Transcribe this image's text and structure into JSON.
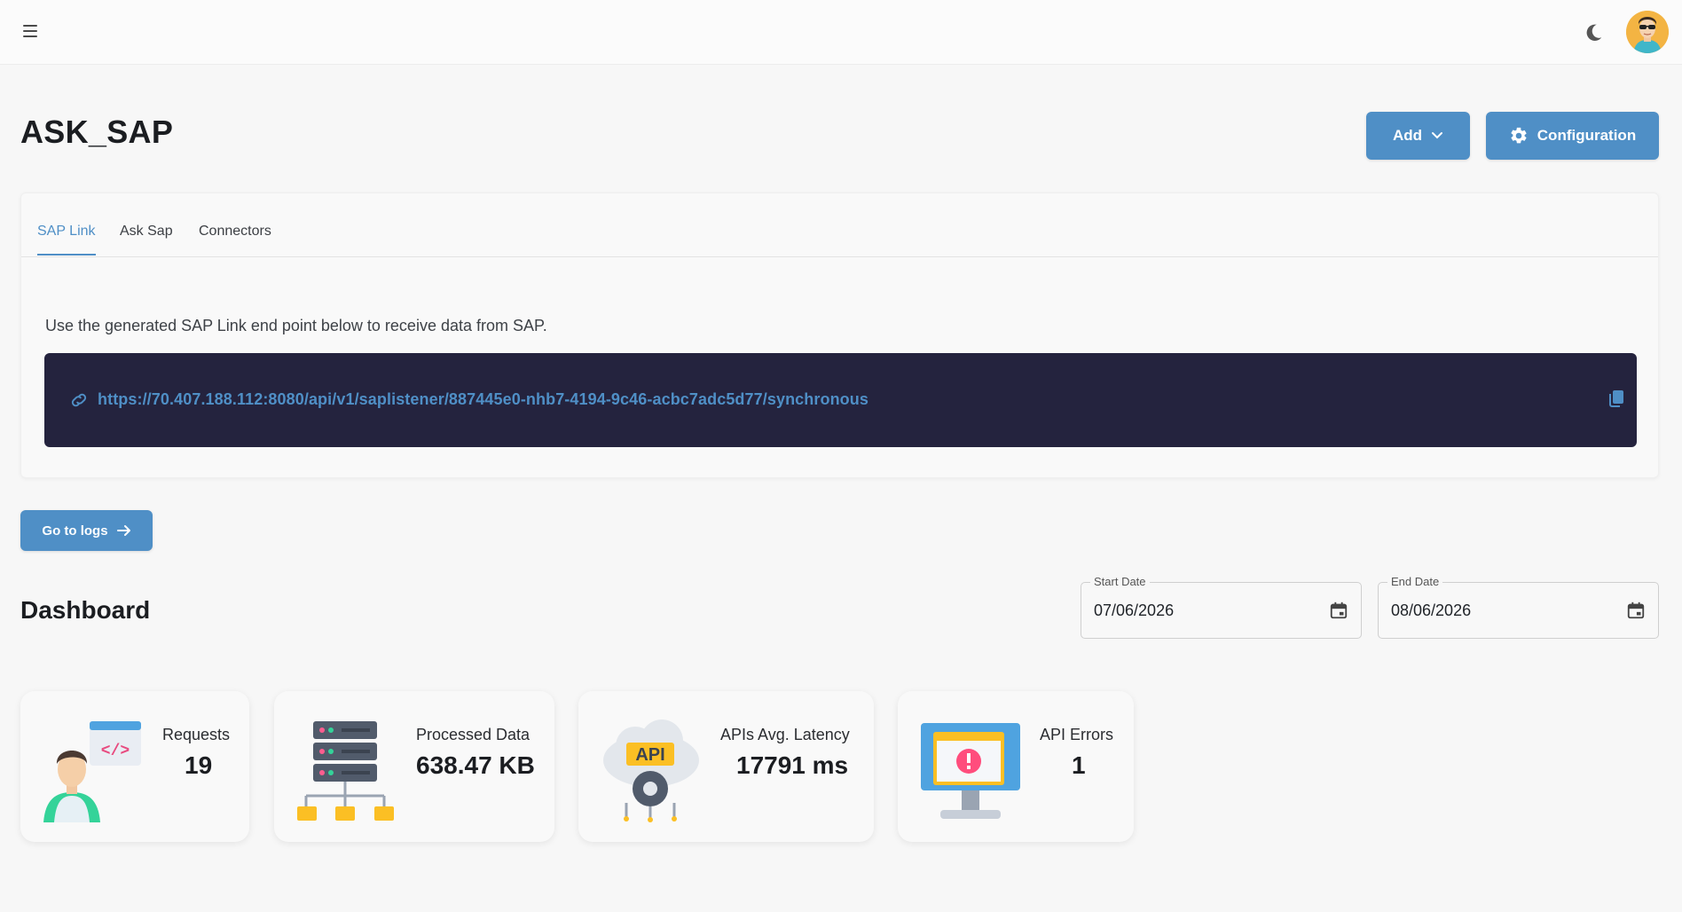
{
  "header": {
    "menu_icon": "hamburger-icon",
    "theme_icon": "moon-icon",
    "avatar_icon": "user-avatar"
  },
  "page": {
    "title": "ASK_SAP",
    "add_label": "Add",
    "config_label": "Configuration"
  },
  "tabs": [
    {
      "label": "SAP Link",
      "active": true
    },
    {
      "label": "Ask Sap",
      "active": false
    },
    {
      "label": "Connectors",
      "active": false
    }
  ],
  "sap_link": {
    "description": "Use the generated SAP Link end point below to receive data from SAP.",
    "url": "https://70.407.188.112:8080/api/v1/saplistener/887445e0-nhb7-4194-9c46-acbc7adc5d77/synchronous"
  },
  "logs_button": "Go to logs",
  "dashboard": {
    "title": "Dashboard",
    "start_date_label": "Start Date",
    "start_date": "07/06/2026",
    "end_date_label": "End Date",
    "end_date": "08/06/2026"
  },
  "stats": [
    {
      "label": "Requests",
      "value": "19",
      "icon": "developer-icon"
    },
    {
      "label": "Processed Data",
      "value": "638.47 KB",
      "icon": "server-icon"
    },
    {
      "label": "APIs Avg. Latency",
      "value": "17791 ms",
      "icon": "api-cloud-icon"
    },
    {
      "label": "API Errors",
      "value": "1",
      "icon": "error-monitor-icon"
    }
  ],
  "colors": {
    "accent": "#4f8fc6",
    "endpoint_bg": "#24233e",
    "page_bg": "#f7f7f7"
  }
}
